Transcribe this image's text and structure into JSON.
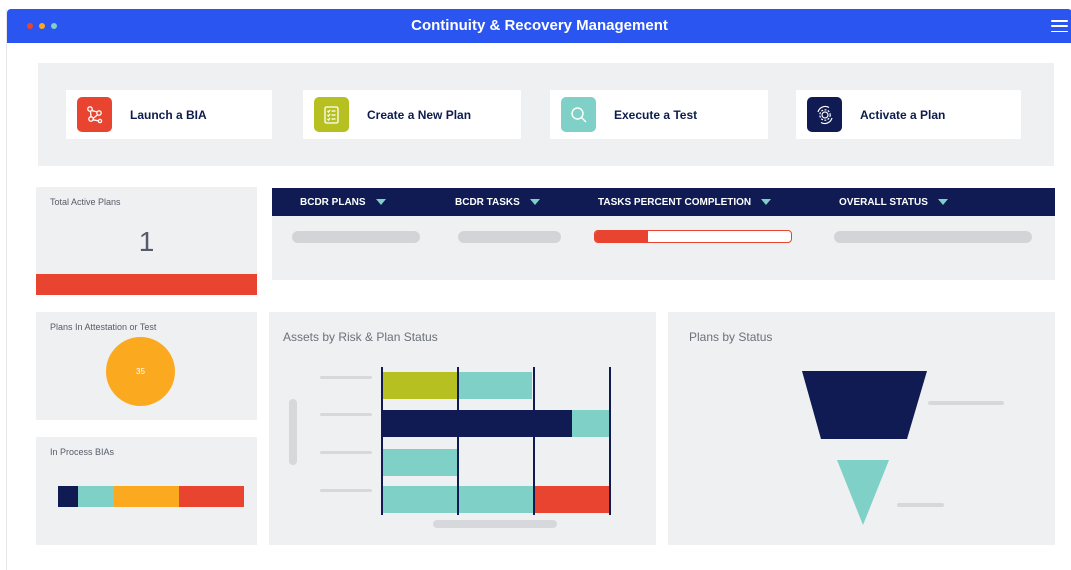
{
  "window": {
    "title": "Continuity & Recovery Management",
    "dot_colors": [
      "#e8442f",
      "#fbaa1f",
      "#7fd0c6"
    ]
  },
  "actions": [
    {
      "label": "Launch a BIA",
      "icon": "network-nodes-icon",
      "color": "#e8442f"
    },
    {
      "label": "Create a New Plan",
      "icon": "checklist-document-icon",
      "color": "#b6c021"
    },
    {
      "label": "Execute a Test",
      "icon": "magnifier-icon",
      "color": "#7fd0c6"
    },
    {
      "label": "Activate a Plan",
      "icon": "gear-cycle-icon",
      "color": "#0f1b52"
    }
  ],
  "total_active_plans": {
    "label": "Total Active Plans",
    "value": "1"
  },
  "plans_table": {
    "columns": [
      "BCDR PLANS",
      "BCDR TASKS",
      "TASKS PERCENT COMPLETION",
      "OVERALL STATUS"
    ],
    "completion_fraction": 0.27
  },
  "plans_in_attestation": {
    "label": "Plans In Attestation or Test",
    "value": "35"
  },
  "in_process_bias": {
    "label": "In Process BIAs",
    "segment_colors": [
      "#0f1b52",
      "#7fd0c6",
      "#fbaa1f",
      "#e8442f"
    ],
    "segment_shares": [
      0.11,
      0.19,
      0.35,
      0.35
    ]
  },
  "assets_chart": {
    "title": "Assets by Risk & Plan Status"
  },
  "plans_by_status": {
    "title": "Plans by Status"
  },
  "colors": {
    "accent_blue": "#2a55f0",
    "navy": "#0f1b52",
    "teal": "#7fd0c6",
    "olive": "#b6c021",
    "orange": "#fbaa1f",
    "red": "#e8442f"
  }
}
